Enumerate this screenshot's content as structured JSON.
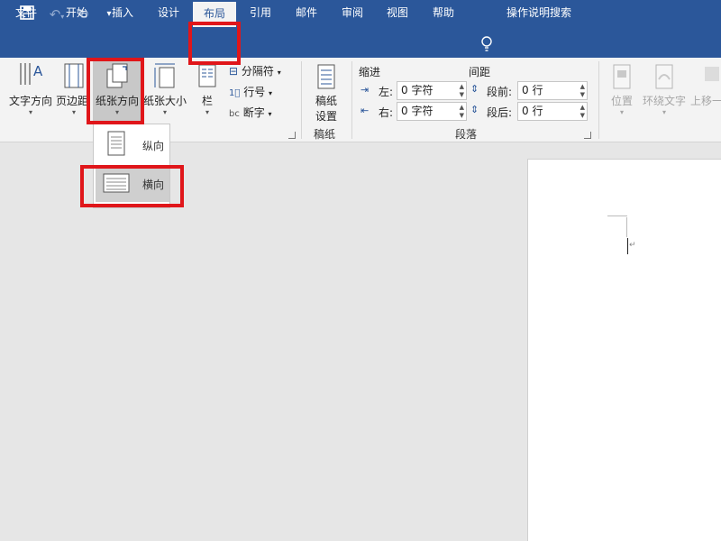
{
  "qat": {
    "save_icon": "save-icon",
    "undo_icon": "undo-icon",
    "redo_icon": "redo-icon",
    "customize_icon": "customize-qat-icon"
  },
  "tabs": [
    {
      "label": "文件"
    },
    {
      "label": "开始"
    },
    {
      "label": "插入"
    },
    {
      "label": "设计"
    },
    {
      "label": "布局",
      "active": true
    },
    {
      "label": "引用"
    },
    {
      "label": "邮件"
    },
    {
      "label": "审阅"
    },
    {
      "label": "视图"
    },
    {
      "label": "帮助"
    }
  ],
  "tell_me": {
    "label": "操作说明搜索",
    "icon": "lightbulb-icon"
  },
  "ribbon": {
    "page_setup": {
      "text_direction": "文字方向",
      "margins": "页边距",
      "orientation": "纸张方向",
      "size": "纸张大小",
      "columns": "栏",
      "breaks": "分隔符",
      "line_numbers": "行号",
      "hyphenation": "断字"
    },
    "manuscript": {
      "button": "稿纸",
      "button_line2": "设置",
      "group_label": "稿纸"
    },
    "paragraph": {
      "indent_header": "缩进",
      "spacing_header": "间距",
      "left_label": "左:",
      "left_value": "0 字符",
      "right_label": "右:",
      "right_value": "0 字符",
      "before_label": "段前:",
      "before_value": "0 行",
      "after_label": "段后:",
      "after_value": "0 行",
      "group_label": "段落"
    },
    "arrange": {
      "position": "位置",
      "wrap_text": "环绕文字",
      "bring_forward": "上移一"
    }
  },
  "orientation_menu": {
    "portrait": "纵向",
    "landscape": "横向"
  },
  "colors": {
    "brand": "#2b579a",
    "highlight": "#e0161a"
  }
}
